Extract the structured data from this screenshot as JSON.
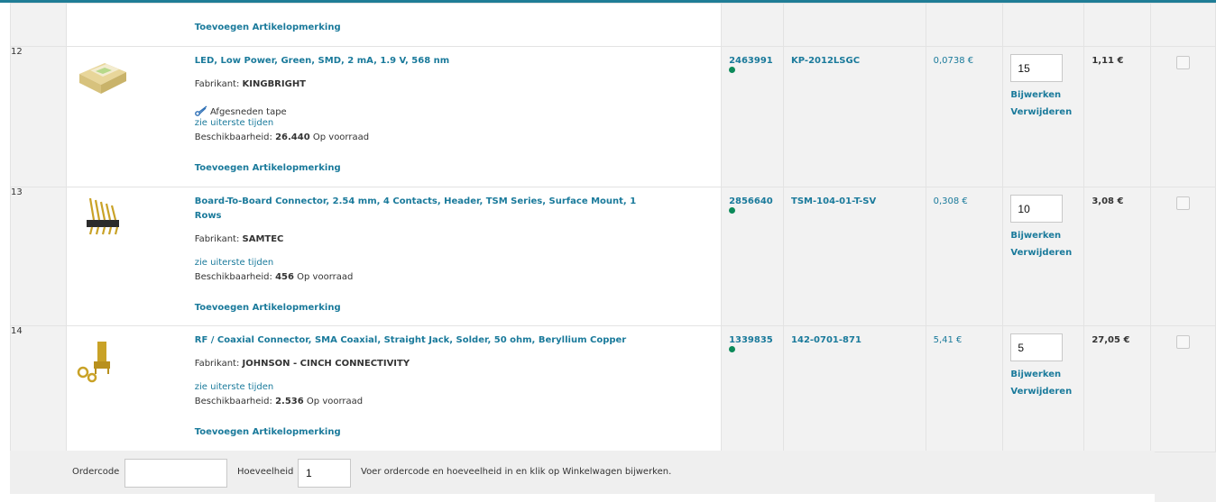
{
  "colors": {
    "accent": "#1f7d96",
    "link": "#1a7a9b",
    "stock_dot": "#0c8a5a"
  },
  "top_row": {
    "note_link": "Toevoegen Artikelopmerking"
  },
  "rows": [
    {
      "num": "12",
      "title": "LED, Low Power, Green, SMD, 2 mA, 1.9 V, 568 nm",
      "manufacturer_label": "Fabrikant:",
      "manufacturer": "KINGBRIGHT",
      "packaging": "Afgesneden tape",
      "packaging_icon": "scissors-icon",
      "lead_time_link": "zie uiterste tijden",
      "availability_label": "Beschikbaarheid:",
      "availability_qty": "26.440",
      "availability_text": "Op voorraad",
      "note_link": "Toevoegen Artikelopmerking",
      "order_code": "2463991",
      "mfr_part": "KP-2012LSGC",
      "unit_price": "0,0738 €",
      "quantity": "15",
      "update_label": "Bijwerken",
      "remove_label": "Verwijderen",
      "line_total": "1,11 €"
    },
    {
      "num": "13",
      "title": "Board-To-Board Connector, 2.54 mm, 4 Contacts, Header, TSM Series, Surface Mount, 1 Rows",
      "manufacturer_label": "Fabrikant:",
      "manufacturer": "SAMTEC",
      "lead_time_link": "zie uiterste tijden",
      "availability_label": "Beschikbaarheid:",
      "availability_qty": "456",
      "availability_text": "Op voorraad",
      "note_link": "Toevoegen Artikelopmerking",
      "order_code": "2856640",
      "mfr_part": "TSM-104-01-T-SV",
      "unit_price": "0,308 €",
      "quantity": "10",
      "update_label": "Bijwerken",
      "remove_label": "Verwijderen",
      "line_total": "3,08 €"
    },
    {
      "num": "14",
      "title": "RF / Coaxial Connector, SMA Coaxial, Straight Jack, Solder, 50 ohm, Beryllium Copper",
      "manufacturer_label": "Fabrikant:",
      "manufacturer": "JOHNSON - CINCH CONNECTIVITY",
      "lead_time_link": "zie uiterste tijden",
      "availability_label": "Beschikbaarheid:",
      "availability_qty": "2.536",
      "availability_text": "Op voorraad",
      "note_link": "Toevoegen Artikelopmerking",
      "order_code": "1339835",
      "mfr_part": "142-0701-871",
      "unit_price": "5,41 €",
      "quantity": "5",
      "update_label": "Bijwerken",
      "remove_label": "Verwijderen",
      "line_total": "27,05 €"
    }
  ],
  "quick_add": {
    "ordercode_label": "Ordercode",
    "ordercode_value": "",
    "quantity_label": "Hoeveelheid",
    "quantity_value": "1",
    "instruction": "Voer ordercode en hoeveelheid in en klik op Winkelwagen bijwerken."
  }
}
